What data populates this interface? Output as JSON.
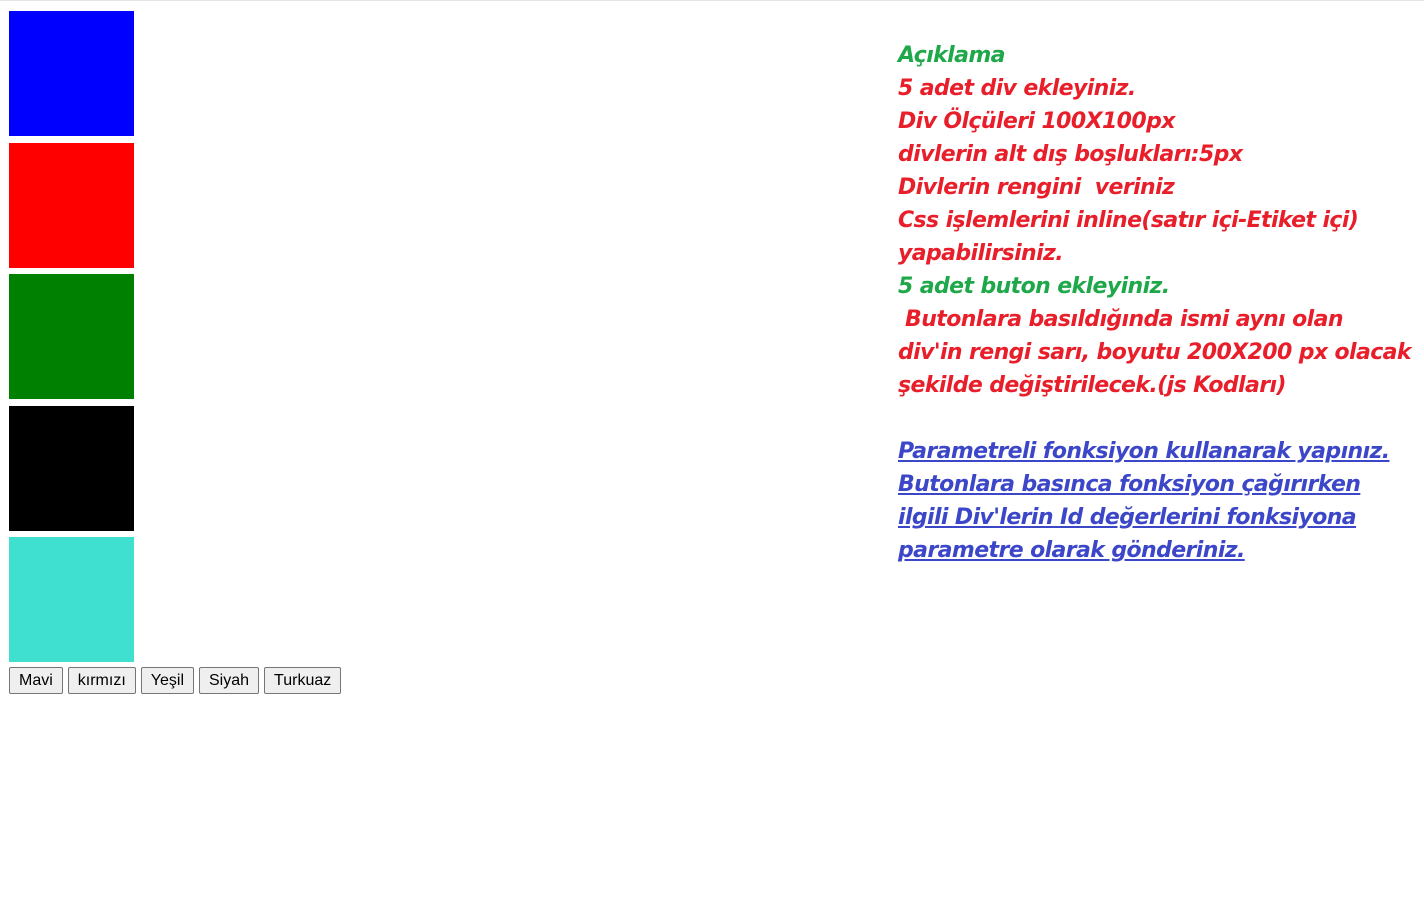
{
  "boxes": [
    {
      "id": "mavi",
      "color": "#0000ff"
    },
    {
      "id": "kirmizi",
      "color": "#ff0000"
    },
    {
      "id": "yesil",
      "color": "#008000"
    },
    {
      "id": "siyah",
      "color": "#000000"
    },
    {
      "id": "turkuaz",
      "color": "#40e0d0"
    }
  ],
  "buttons": {
    "mavi": "Mavi",
    "kirmizi": "kırmızı",
    "yesil": "Yeşil",
    "siyah": "Siyah",
    "turkuaz": "Turkuaz"
  },
  "colors": {
    "green_text": "#1fa84a",
    "red_text": "#e81f2a",
    "blue_link": "#3c46c8"
  },
  "description": {
    "heading": "Açıklama",
    "lines": [
      "5 adet div ekleyiniz.",
      "Div Ölçüleri 100X100px",
      "divlerin alt dış boşlukları:5px",
      "Divlerin rengini  veriniz",
      "Css işlemlerini inline(satır içi-Etiket içi)",
      "yapabilirsiniz."
    ],
    "buttons_heading": "5 adet buton ekleyiniz.",
    "button_lines": [
      " Butonlara basıldığında ismi aynı olan",
      "div'in rengi sarı, boyutu 200X200 px olacak",
      "şekilde değiştirilecek.(js Kodları)"
    ],
    "link_lines": [
      "Parametreli fonksiyon kullanarak yapınız.",
      "Butonlara basınca fonksiyon çağırırken",
      "ilgili Div'lerin Id değerlerini fonksiyona",
      "parametre olarak gönderiniz."
    ]
  }
}
